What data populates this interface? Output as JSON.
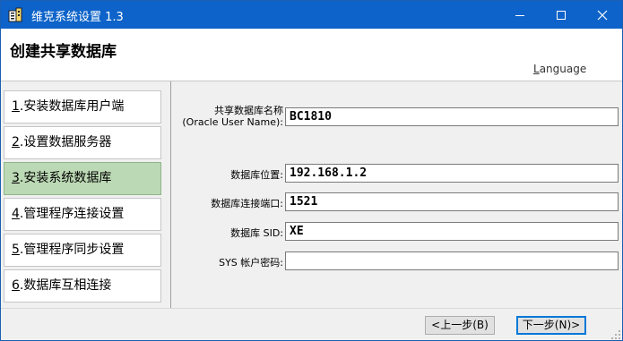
{
  "window": {
    "title": "维克系统设置 1.3",
    "icon": "app-icon",
    "controls": {
      "minimize_icon": "minimize-icon",
      "maximize_icon": "maximize-icon",
      "close_icon": "close-icon"
    }
  },
  "header": {
    "title": "创建共享数据库",
    "language_prefix": "L",
    "language_rest": "anguage"
  },
  "steps": [
    {
      "num": "1",
      "label": ".安装数据库用户端",
      "active": false
    },
    {
      "num": "2",
      "label": ".设置数据服务器",
      "active": false
    },
    {
      "num": "3",
      "label": ".安装系统数据库",
      "active": true
    },
    {
      "num": "4",
      "label": ".管理程序连接设置",
      "active": false
    },
    {
      "num": "5",
      "label": ".管理程序同步设置",
      "active": false
    },
    {
      "num": "6",
      "label": ".数据库互相连接",
      "active": false
    }
  ],
  "form": {
    "db_name_label": "共享数据库名称",
    "db_name_sublabel": "(Oracle User Name):",
    "db_name_value": "BC1810",
    "db_location_label": "数据库位置:",
    "db_location_value": "192.168.1.2",
    "db_port_label": "数据库连接端口:",
    "db_port_value": "1521",
    "db_sid_label": "数据库 SID:",
    "db_sid_value": "XE",
    "sys_password_label": "SYS 帐户密码:",
    "sys_password_value": ""
  },
  "footer": {
    "prev_label": "<上一步(B)",
    "next_label": "下一步(N)>"
  },
  "colors": {
    "titlebar": "#0d63c9",
    "active_step": "#bcd9b5",
    "body_bg": "#f0f0f0",
    "default_button_border": "#0078d7"
  }
}
